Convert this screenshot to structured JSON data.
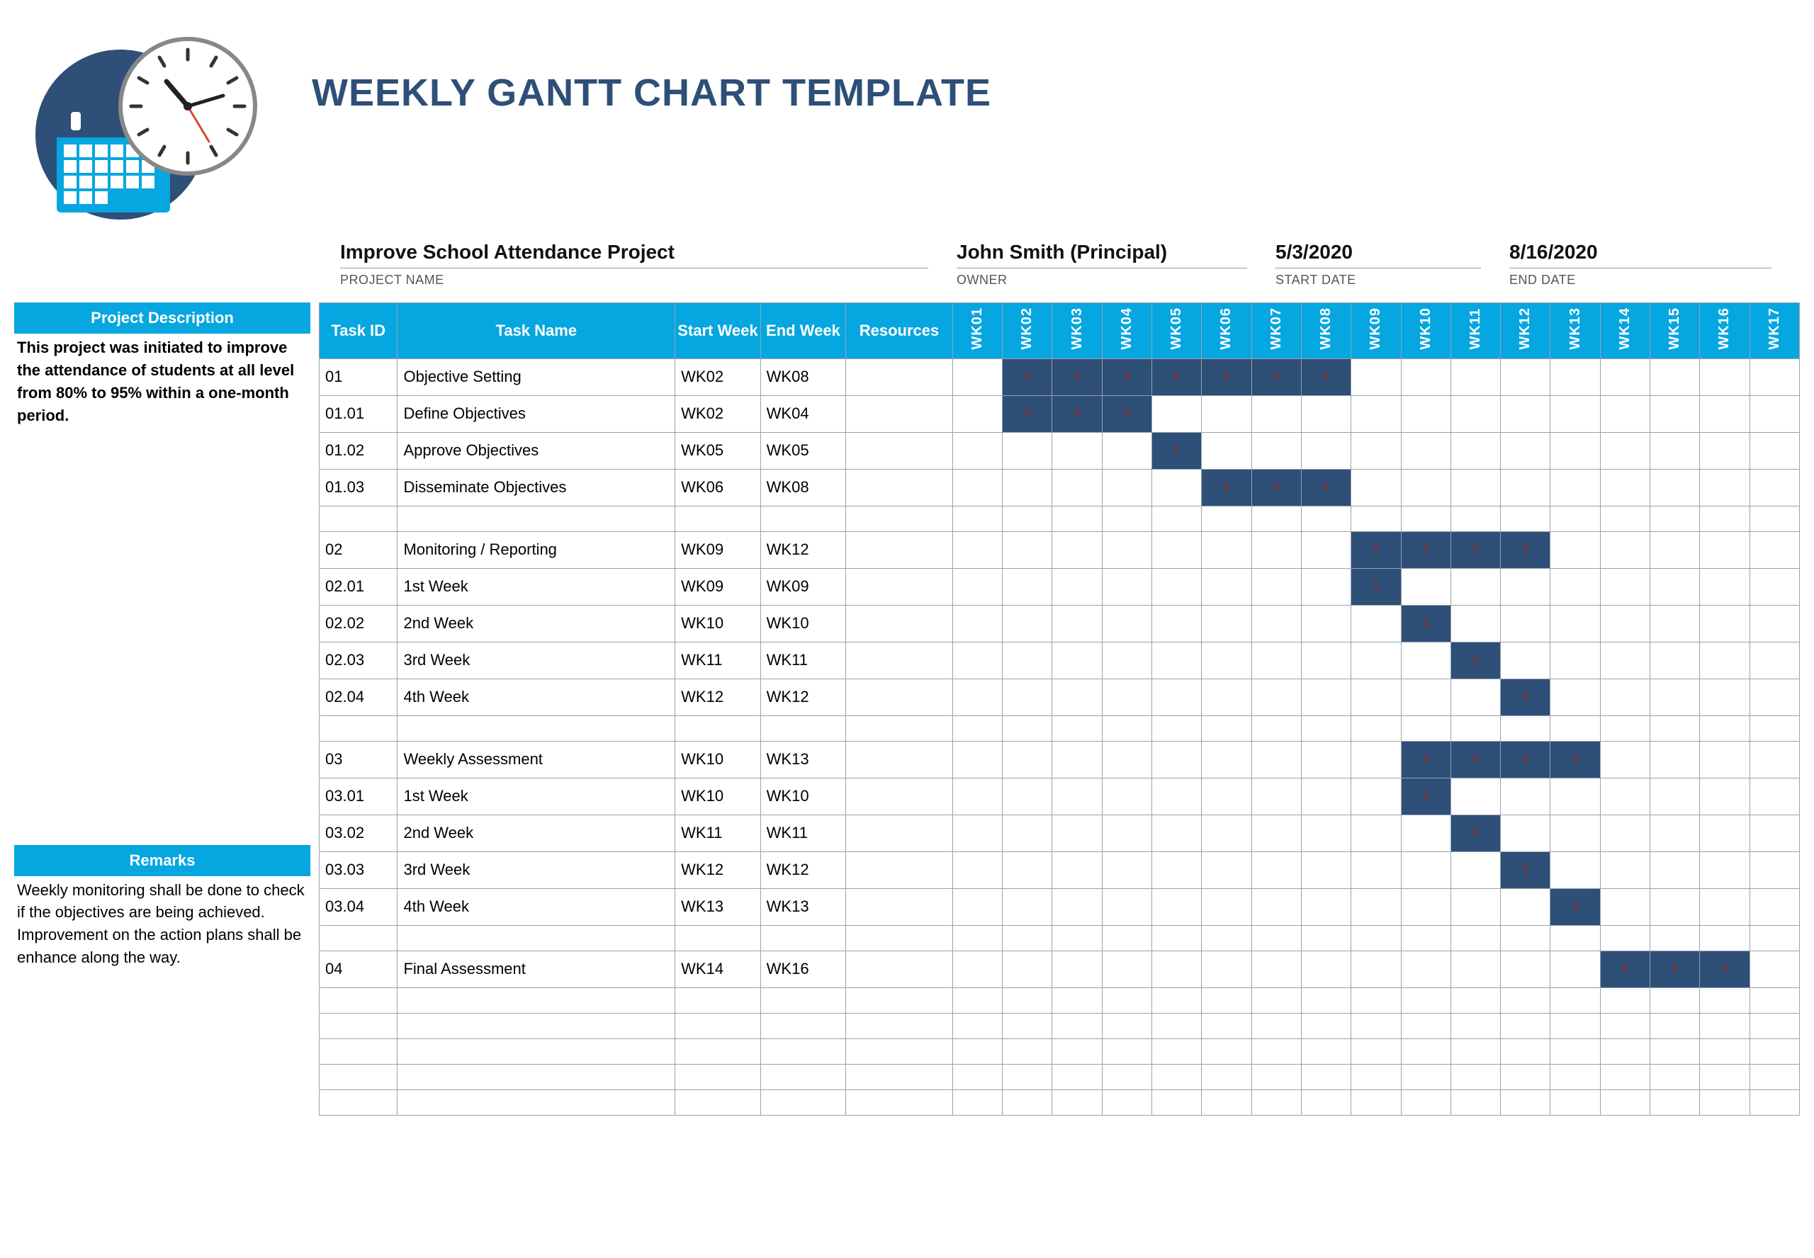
{
  "header": {
    "title": "WEEKLY GANTT CHART TEMPLATE"
  },
  "meta": {
    "project_name": {
      "value": "Improve School Attendance Project",
      "label": "PROJECT NAME"
    },
    "owner": {
      "value": "John Smith (Principal)",
      "label": "OWNER"
    },
    "start_date": {
      "value": "5/3/2020",
      "label": "START DATE"
    },
    "end_date": {
      "value": "8/16/2020",
      "label": "END DATE"
    }
  },
  "sidebar": {
    "desc_h": "Project Description",
    "desc_b": "This project was initiated to improve the attendance of students at all level from 80% to 95% within a one-month period.",
    "rem_h": "Remarks",
    "rem_b": "Weekly monitoring shall be done to check if the objectives are being achieved.\nImprovement on the action plans shall be enhance along the way."
  },
  "columns": {
    "task_id": "Task ID",
    "task_name": "Task Name",
    "start_week": "Start Week",
    "end_week": "End Week",
    "resources": "Resources"
  },
  "weeks": [
    "WK01",
    "WK02",
    "WK03",
    "WK04",
    "WK05",
    "WK06",
    "WK07",
    "WK08",
    "WK09",
    "WK10",
    "WK11",
    "WK12",
    "WK13",
    "WK14",
    "WK15",
    "WK16",
    "WK17"
  ],
  "chart_data": {
    "type": "table",
    "title": "WEEKLY GANTT CHART TEMPLATE",
    "xlabel": "Week",
    "ylabel": "Task",
    "x": [
      "WK01",
      "WK02",
      "WK03",
      "WK04",
      "WK05",
      "WK06",
      "WK07",
      "WK08",
      "WK09",
      "WK10",
      "WK11",
      "WK12",
      "WK13",
      "WK14",
      "WK15",
      "WK16",
      "WK17"
    ],
    "rows": [
      {
        "id": "01",
        "name": "Objective Setting",
        "start": "WK02",
        "end": "WK08",
        "resources": "",
        "bars": [
          2,
          3,
          4,
          5,
          6,
          7,
          8
        ]
      },
      {
        "id": "01.01",
        "name": "Define Objectives",
        "start": "WK02",
        "end": "WK04",
        "resources": "",
        "bars": [
          2,
          3,
          4
        ]
      },
      {
        "id": "01.02",
        "name": "Approve Objectives",
        "start": "WK05",
        "end": "WK05",
        "resources": "",
        "bars": [
          5
        ]
      },
      {
        "id": "01.03",
        "name": "Disseminate Objectives",
        "start": "WK06",
        "end": "WK08",
        "resources": "",
        "bars": [
          6,
          7,
          8
        ]
      },
      {
        "blank": true
      },
      {
        "id": "02",
        "name": "Monitoring / Reporting",
        "start": "WK09",
        "end": "WK12",
        "resources": "",
        "bars": [
          9,
          10,
          11,
          12
        ]
      },
      {
        "id": "02.01",
        "name": "1st Week",
        "start": "WK09",
        "end": "WK09",
        "resources": "",
        "bars": [
          9
        ]
      },
      {
        "id": "02.02",
        "name": "2nd Week",
        "start": "WK10",
        "end": "WK10",
        "resources": "",
        "bars": [
          10
        ]
      },
      {
        "id": "02.03",
        "name": "3rd Week",
        "start": "WK11",
        "end": "WK11",
        "resources": "",
        "bars": [
          11
        ]
      },
      {
        "id": "02.04",
        "name": "4th Week",
        "start": "WK12",
        "end": "WK12",
        "resources": "",
        "bars": [
          12
        ]
      },
      {
        "blank": true
      },
      {
        "id": "03",
        "name": "Weekly Assessment",
        "start": "WK10",
        "end": "WK13",
        "resources": "",
        "bars": [
          10,
          11,
          12,
          13
        ]
      },
      {
        "id": "03.01",
        "name": "1st Week",
        "start": "WK10",
        "end": "WK10",
        "resources": "",
        "bars": [
          10
        ]
      },
      {
        "id": "03.02",
        "name": "2nd Week",
        "start": "WK11",
        "end": "WK11",
        "resources": "",
        "bars": [
          11
        ]
      },
      {
        "id": "03.03",
        "name": "3rd Week",
        "start": "WK12",
        "end": "WK12",
        "resources": "",
        "bars": [
          12
        ]
      },
      {
        "id": "03.04",
        "name": "4th Week",
        "start": "WK13",
        "end": "WK13",
        "resources": "",
        "bars": [
          13
        ]
      },
      {
        "blank": true
      },
      {
        "id": "04",
        "name": "Final Assessment",
        "start": "WK14",
        "end": "WK16",
        "resources": "",
        "bars": [
          14,
          15,
          16
        ]
      },
      {
        "blank": true
      },
      {
        "blank": true
      },
      {
        "blank": true
      },
      {
        "blank": true
      },
      {
        "blank": true
      }
    ]
  }
}
